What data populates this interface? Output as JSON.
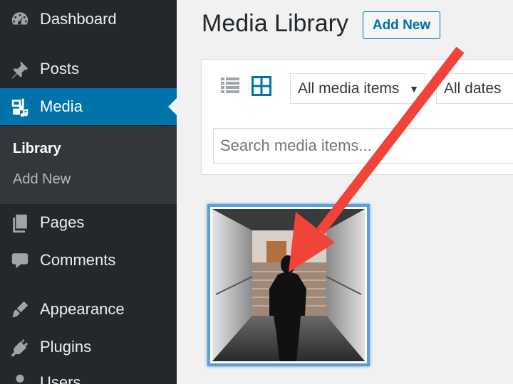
{
  "sidebar": {
    "items": [
      {
        "label": "Dashboard",
        "icon": "dashboard-icon"
      },
      {
        "label": "Posts",
        "icon": "pin-icon"
      },
      {
        "label": "Media",
        "icon": "media-icon"
      },
      {
        "label": "Pages",
        "icon": "pages-icon"
      },
      {
        "label": "Comments",
        "icon": "comment-icon"
      },
      {
        "label": "Appearance",
        "icon": "brush-icon"
      },
      {
        "label": "Plugins",
        "icon": "plug-icon"
      },
      {
        "label": "Users",
        "icon": "user-icon"
      }
    ],
    "current": "Media",
    "submenu": [
      {
        "label": "Library",
        "active": true
      },
      {
        "label": "Add New",
        "active": false
      }
    ]
  },
  "header": {
    "title": "Media Library",
    "add_new_label": "Add New"
  },
  "toolbar": {
    "view_modes": [
      "list-view-icon",
      "grid-view-icon"
    ],
    "active_view": "grid",
    "type_filter": "All media items",
    "date_filter": "All dates",
    "search_placeholder": "Search media items..."
  },
  "media": [
    {
      "description": "silhouette of person walking toward end of corridor",
      "selected": true
    }
  ],
  "colors": {
    "sidebar_bg": "#23282d",
    "submenu_bg": "#32373c",
    "accent": "#0073aa",
    "page_bg": "#f1f1f1",
    "annotation_arrow": "#f04438"
  }
}
